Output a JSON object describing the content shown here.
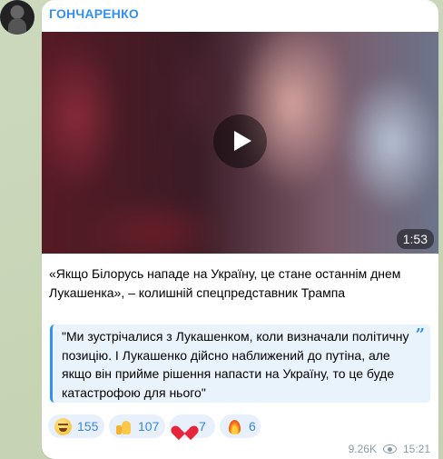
{
  "channel": {
    "name": "ГОНЧАРЕНКО"
  },
  "video": {
    "duration": "1:53"
  },
  "post": {
    "caption": "«Якщо Білорусь нападе на Україну, це стане останнім днем Лукашенка», – колишній спецпредставник Трампа",
    "quote": "\"Ми зустрічалися з Лукашенком, коли визначали політичну позицію. І Лукашенко дійсно наближений до путіна, але якщо він прийме рішення напасти на Україну, то це буде катастрофою для нього\"",
    "quote_mark": "”"
  },
  "reactions": [
    {
      "icon": "grinning-face-icon",
      "count": "155"
    },
    {
      "icon": "thumbs-up-icon",
      "count": "107"
    },
    {
      "icon": "red-heart-icon",
      "count": "7"
    },
    {
      "icon": "fire-icon",
      "count": "6"
    }
  ],
  "meta": {
    "views": "9.26K",
    "time": "15:21"
  },
  "colors": {
    "accent": "#3390ec",
    "quote_bg": "#e9f3fc",
    "reaction_bg": "#e8f1fb"
  }
}
